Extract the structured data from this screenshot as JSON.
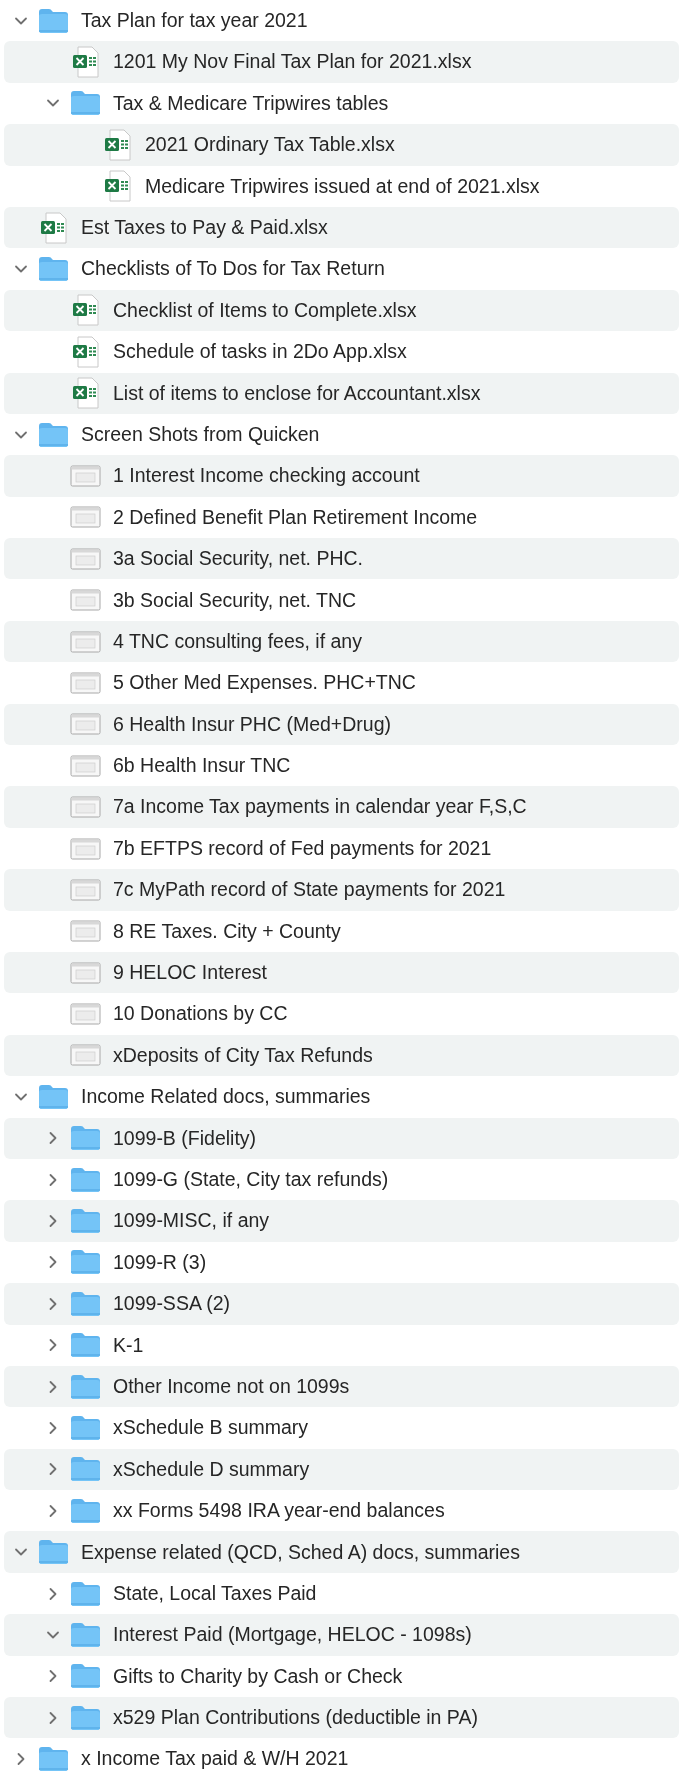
{
  "items": [
    {
      "kind": "folder",
      "name": "Tax Plan for tax year 2021",
      "expanded": true,
      "children": [
        {
          "kind": "spreadsheet",
          "name": "1201 My Nov Final Tax Plan for 2021.xlsx"
        },
        {
          "kind": "folder",
          "name": "Tax & Medicare Tripwires tables",
          "expanded": true,
          "children": [
            {
              "kind": "spreadsheet",
              "name": "2021 Ordinary Tax Table.xlsx"
            },
            {
              "kind": "spreadsheet",
              "name": "Medicare Tripwires issued at end of 2021.xlsx"
            }
          ]
        }
      ]
    },
    {
      "kind": "spreadsheet",
      "name": "Est Taxes to Pay & Paid.xlsx"
    },
    {
      "kind": "folder",
      "name": "Checklists of To Dos for Tax Return",
      "expanded": true,
      "children": [
        {
          "kind": "spreadsheet",
          "name": "Checklist of Items to Complete.xlsx"
        },
        {
          "kind": "spreadsheet",
          "name": "Schedule of tasks in 2Do App.xlsx"
        },
        {
          "kind": "spreadsheet",
          "name": "List of items to enclose for Accountant.xlsx"
        }
      ]
    },
    {
      "kind": "folder",
      "name": "Screen Shots from Quicken",
      "expanded": true,
      "children": [
        {
          "kind": "screenshot",
          "name": "1 Interest Income checking account"
        },
        {
          "kind": "screenshot",
          "name": "2 Defined Benefit Plan Retirement Income"
        },
        {
          "kind": "screenshot",
          "name": "3a Social Security, net. PHC."
        },
        {
          "kind": "screenshot",
          "name": "3b Social Security, net. TNC"
        },
        {
          "kind": "screenshot",
          "name": "4 TNC consulting fees, if any"
        },
        {
          "kind": "screenshot",
          "name": "5 Other Med Expenses. PHC+TNC"
        },
        {
          "kind": "screenshot",
          "name": "6 Health Insur PHC (Med+Drug)"
        },
        {
          "kind": "screenshot",
          "name": "6b Health Insur TNC"
        },
        {
          "kind": "screenshot",
          "name": "7a Income Tax payments in calendar year F,S,C"
        },
        {
          "kind": "screenshot",
          "name": "7b EFTPS record of Fed payments for 2021"
        },
        {
          "kind": "screenshot",
          "name": "7c MyPath record of State payments for 2021"
        },
        {
          "kind": "screenshot",
          "name": "8 RE Taxes. City + County"
        },
        {
          "kind": "screenshot",
          "name": "9 HELOC Interest"
        },
        {
          "kind": "screenshot",
          "name": "10 Donations by CC"
        },
        {
          "kind": "screenshot",
          "name": "xDeposits of City Tax Refunds"
        }
      ]
    },
    {
      "kind": "folder",
      "name": "Income Related docs, summaries",
      "expanded": true,
      "children": [
        {
          "kind": "folder",
          "name": "1099-B (Fidelity)",
          "expanded": false
        },
        {
          "kind": "folder",
          "name": "1099-G (State, City tax refunds)",
          "expanded": false
        },
        {
          "kind": "folder",
          "name": "1099-MISC, if any",
          "expanded": false
        },
        {
          "kind": "folder",
          "name": "1099-R (3)",
          "expanded": false
        },
        {
          "kind": "folder",
          "name": "1099-SSA (2)",
          "expanded": false
        },
        {
          "kind": "folder",
          "name": "K-1",
          "expanded": false
        },
        {
          "kind": "folder",
          "name": "Other Income not on 1099s",
          "expanded": false
        },
        {
          "kind": "folder",
          "name": "xSchedule B summary",
          "expanded": false
        },
        {
          "kind": "folder",
          "name": "xSchedule D summary",
          "expanded": false
        },
        {
          "kind": "folder",
          "name": "xx Forms 5498 IRA year-end balances",
          "expanded": false
        }
      ]
    },
    {
      "kind": "folder",
      "name": "Expense related (QCD, Sched A) docs, summaries",
      "expanded": true,
      "children": [
        {
          "kind": "folder",
          "name": "State, Local Taxes Paid",
          "expanded": false
        },
        {
          "kind": "folder",
          "name": "Interest Paid (Mortgage, HELOC - 1098s)",
          "expanded": true
        },
        {
          "kind": "folder",
          "name": "Gifts to Charity by Cash or Check",
          "expanded": false
        },
        {
          "kind": "folder",
          "name": "x529 Plan Contributions (deductible in PA)",
          "expanded": false
        }
      ]
    },
    {
      "kind": "folder",
      "name": "x Income Tax paid & W/H 2021",
      "expanded": false
    }
  ]
}
